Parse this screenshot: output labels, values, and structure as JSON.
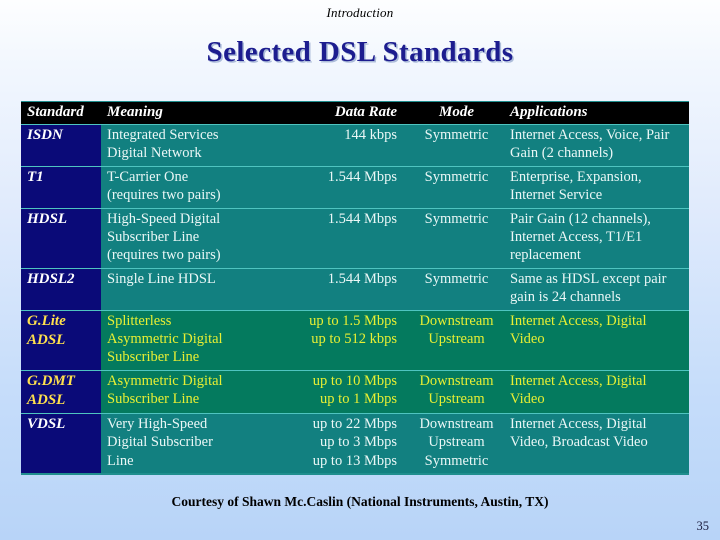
{
  "slide": {
    "kicker": "Introduction",
    "title": "Selected DSL Standards",
    "credit": "Courtesy of Shawn Mc.Caslin (National Instruments, Austin, TX)",
    "page_number": "35",
    "colors": {
      "background_top": "#fdfeff",
      "background_bottom": "#b8d4f8",
      "title_text": "#1d1d8f",
      "header_row_bg": "#000000",
      "header_row_text": "#ffffff",
      "standard_col_bg": "#0a0a78",
      "standard_col_text": "#ffffff",
      "body_cell_bg": "#128080",
      "body_cell_text": "#eaf7f6",
      "highlight_cell_bg": "#047a5e",
      "highlight_cell_text": "#e8ef33",
      "highlight_standard_text": "#ffe14d",
      "row_divider": "#4fc4c0"
    }
  },
  "table": {
    "columns": [
      {
        "key": "standard",
        "label": "Standard"
      },
      {
        "key": "meaning",
        "label": "Meaning"
      },
      {
        "key": "data_rate",
        "label": "Data Rate"
      },
      {
        "key": "mode",
        "label": "Mode"
      },
      {
        "key": "applications",
        "label": "Applications"
      }
    ],
    "rows": [
      {
        "standard": "ISDN",
        "highlight": false,
        "meaning": [
          "Integrated Services",
          "Digital Network"
        ],
        "data_rate": [
          "144 kbps"
        ],
        "mode": [
          "Symmetric"
        ],
        "applications": [
          "Internet Access, Voice, Pair",
          "Gain (2 channels)"
        ]
      },
      {
        "standard": "T1",
        "highlight": false,
        "meaning": [
          "T-Carrier One",
          "(requires two pairs)"
        ],
        "data_rate": [
          "1.544 Mbps"
        ],
        "mode": [
          "Symmetric"
        ],
        "applications": [
          "Enterprise, Expansion,",
          "Internet Service"
        ]
      },
      {
        "standard": "HDSL",
        "highlight": false,
        "meaning": [
          "High-Speed Digital",
          "Subscriber Line",
          "(requires two pairs)"
        ],
        "data_rate": [
          "1.544 Mbps"
        ],
        "mode": [
          "Symmetric"
        ],
        "applications": [
          "Pair Gain (12 channels),",
          "Internet Access, T1/E1",
          "replacement"
        ]
      },
      {
        "standard": "HDSL2",
        "highlight": false,
        "meaning": [
          "Single Line HDSL"
        ],
        "data_rate": [
          "1.544 Mbps"
        ],
        "mode": [
          "Symmetric"
        ],
        "applications": [
          "Same as HDSL except pair",
          "gain is 24 channels"
        ]
      },
      {
        "standard": "G.Lite\nADSL",
        "highlight": true,
        "meaning": [
          "Splitterless",
          "Asymmetric Digital",
          "Subscriber Line"
        ],
        "data_rate": [
          "up to 1.5 Mbps",
          "up to 512 kbps"
        ],
        "mode": [
          "Downstream",
          "Upstream"
        ],
        "applications": [
          "Internet Access, Digital",
          "Video"
        ]
      },
      {
        "standard": "G.DMT\nADSL",
        "highlight": true,
        "meaning": [
          "Asymmetric Digital",
          "Subscriber Line"
        ],
        "data_rate": [
          "up to 10 Mbps",
          "up to 1 Mbps"
        ],
        "mode": [
          "Downstream",
          "Upstream"
        ],
        "applications": [
          "Internet Access, Digital",
          "Video"
        ]
      },
      {
        "standard": "VDSL",
        "highlight": false,
        "meaning": [
          "Very High-Speed",
          "Digital Subscriber",
          "Line"
        ],
        "data_rate": [
          "up to 22 Mbps",
          "up to 3 Mbps",
          "up to 13 Mbps"
        ],
        "mode": [
          "Downstream",
          "Upstream",
          "Symmetric"
        ],
        "applications": [
          "Internet Access, Digital",
          "Video, Broadcast Video"
        ]
      }
    ]
  }
}
